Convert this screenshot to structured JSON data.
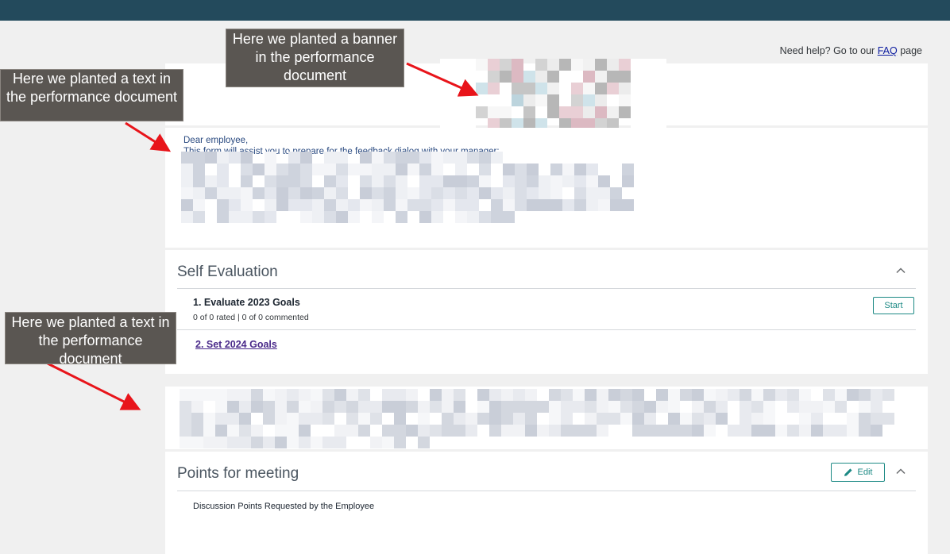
{
  "help": {
    "prefix": "Need help? Go to our",
    "link": "FAQ",
    "suffix": "page"
  },
  "intro": {
    "greeting": "Dear employee,",
    "line2": "This form will assist you to prepare for the feedback dialog with your manager:"
  },
  "self_evaluation": {
    "title": "Self Evaluation",
    "items": [
      {
        "title": "1. Evaluate 2023 Goals",
        "subtitle": "0 of 0 rated | 0 of 0 commented",
        "button": "Start"
      },
      {
        "title": "2. Set 2024 Goals"
      }
    ]
  },
  "points": {
    "title": "Points for meeting",
    "edit_label": "Edit",
    "text": "Discussion Points Requested by the Employee"
  },
  "callouts": {
    "banner": "Here we planted a banner in the performance document",
    "text_top": "Here we planted a text in the performance document",
    "text_bottom": "Here we planted a text in the performance document"
  },
  "colors": {
    "accent": "#1d8a85",
    "header": "#234a5c",
    "arrow": "#e8141a"
  },
  "icons": {
    "collapse": "chevron-up-icon",
    "edit": "pencil-icon"
  }
}
